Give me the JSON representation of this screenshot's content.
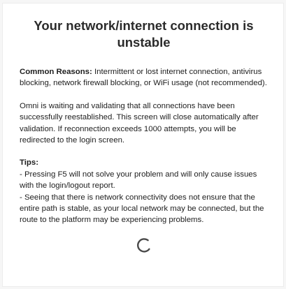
{
  "dialog": {
    "title": "Your network/internet connection is unstable",
    "reasons_label": "Common Reasons:",
    "reasons_text": " Intermittent or lost internet connection, antivirus blocking, network firewall blocking, or WiFi usage (not recommended).",
    "waiting_text": "Omni is waiting and validating that all connections have been successfully reestablished. This screen will close automatically after validation. If reconnection exceeds 1000 attempts, you will be redirected to the login screen.",
    "tips_label": "Tips:",
    "tips": [
      "- Pressing F5 will not solve your problem and will only cause issues with the login/logout report.",
      "- Seeing that there is network connectivity does not ensure that the entire path is stable, as your local network may be connected, but the route to the platform may be experiencing problems."
    ],
    "spinner_icon": "loading-spinner-icon",
    "spinner_color": "#4a4a4a"
  }
}
